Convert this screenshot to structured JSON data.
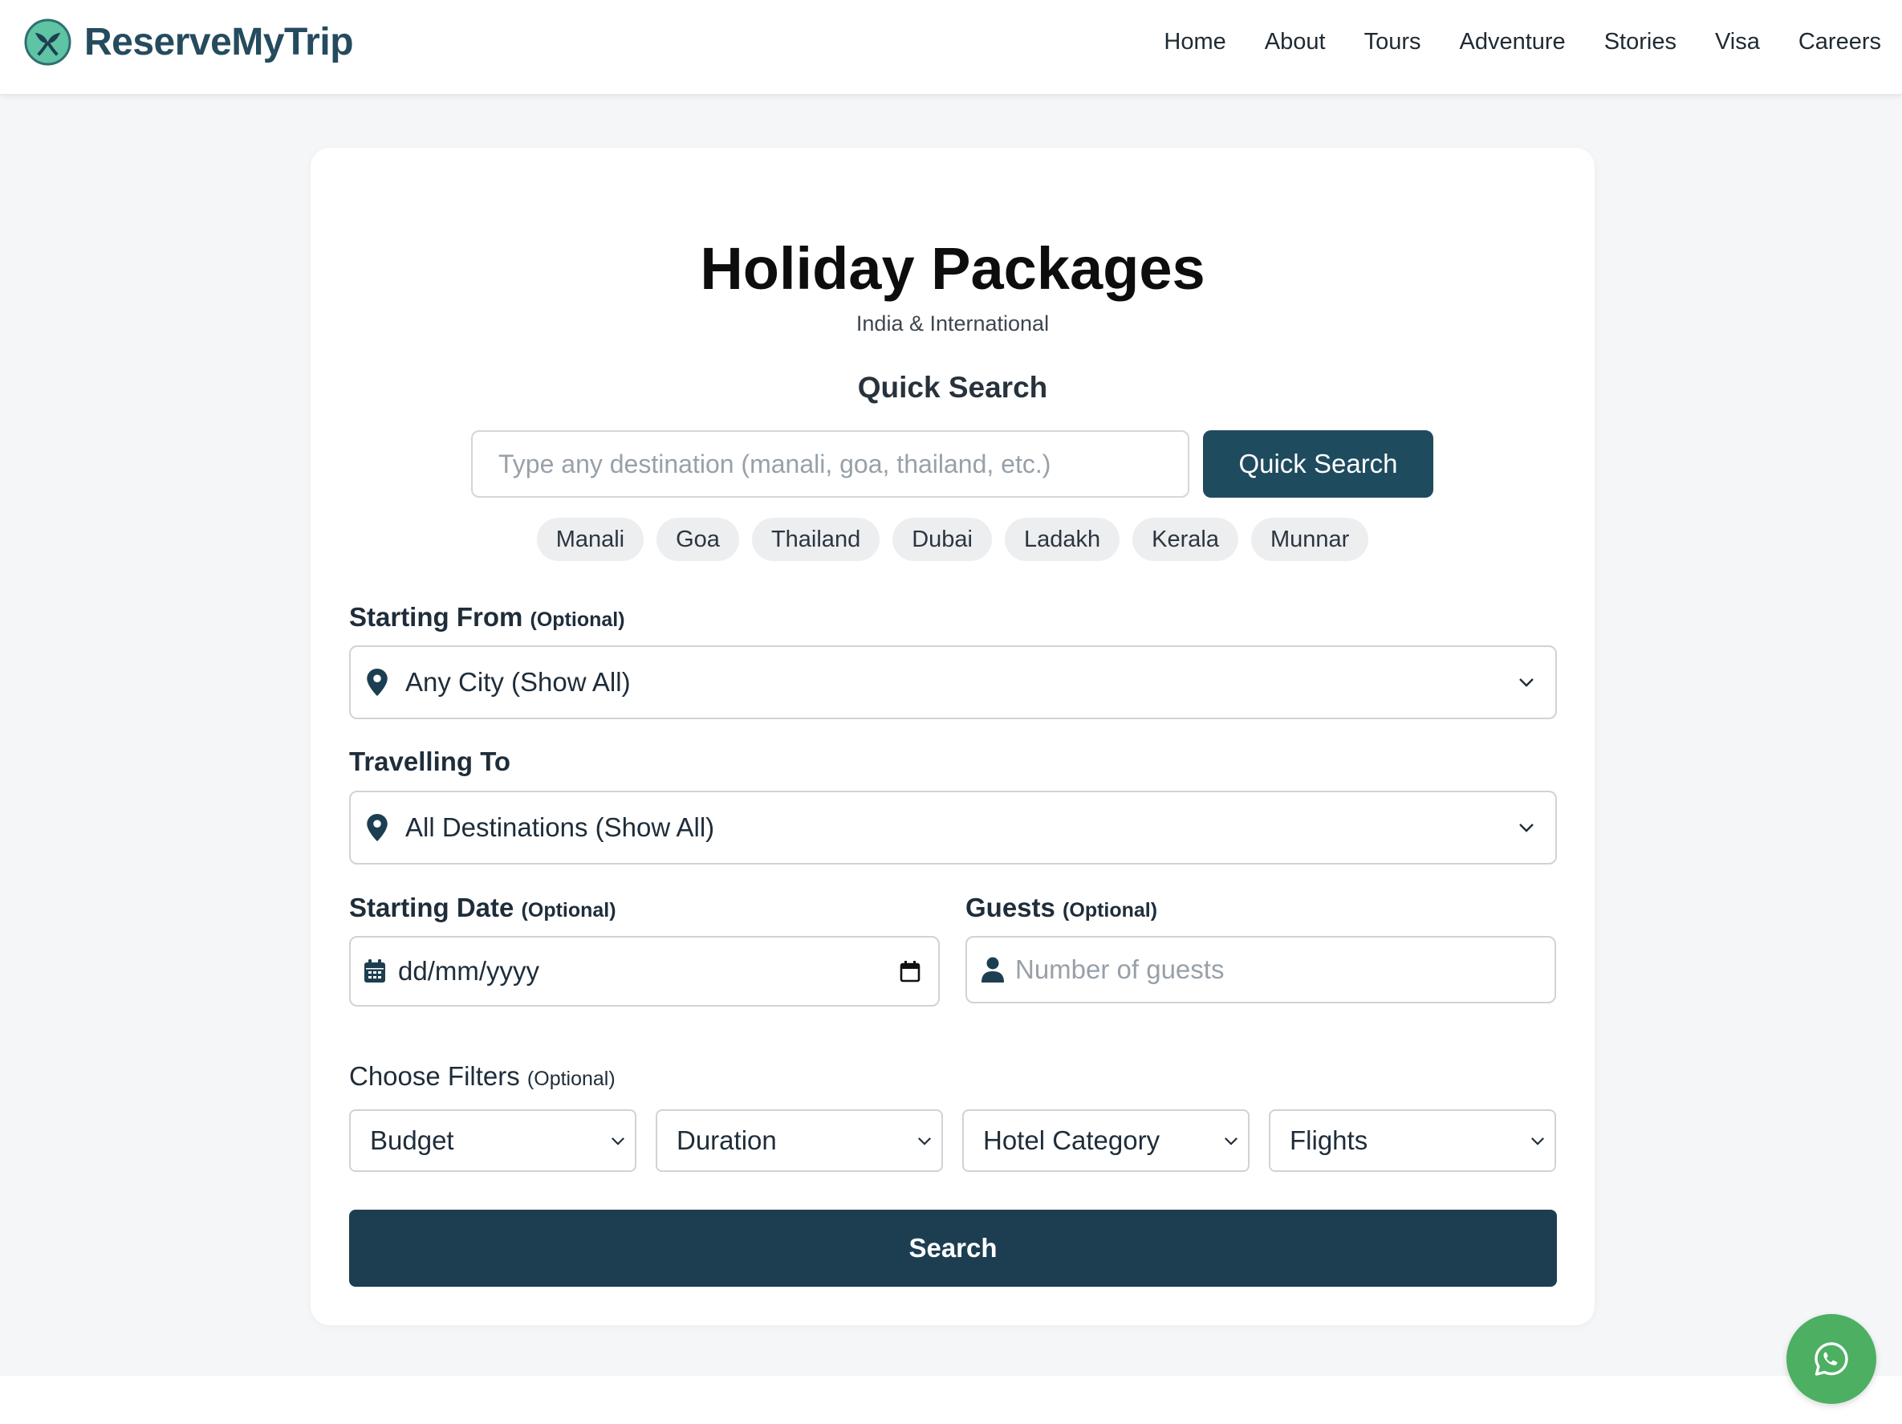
{
  "brand": {
    "name": "ReserveMyTrip",
    "accent": "#1f4b5f",
    "logo_icon": "leaf-globe-icon"
  },
  "nav": [
    "Home",
    "About",
    "Tours",
    "Adventure",
    "Stories",
    "Visa",
    "Careers"
  ],
  "hero": {
    "title": "Holiday Packages",
    "subtitle": "India & International"
  },
  "quick_search": {
    "heading": "Quick Search",
    "placeholder": "Type any destination (manali, goa, thailand, etc.)",
    "button": "Quick Search",
    "chips": [
      "Manali",
      "Goa",
      "Thailand",
      "Dubai",
      "Ladakh",
      "Kerala",
      "Munnar"
    ]
  },
  "form": {
    "starting_from": {
      "label": "Starting From",
      "optional": "(Optional)",
      "value": "Any City (Show All)"
    },
    "travelling_to": {
      "label": "Travelling To",
      "value": "All Destinations (Show All)"
    },
    "starting_date": {
      "label": "Starting Date",
      "optional": "(Optional)",
      "value": "dd/mm/yyyy"
    },
    "guests": {
      "label": "Guests",
      "optional": "(Optional)",
      "placeholder": "Number of guests"
    },
    "filters": {
      "label": "Choose Filters",
      "optional": "(Optional)",
      "items": [
        "Budget",
        "Duration",
        "Hotel Category",
        "Flights"
      ]
    },
    "search_button": "Search"
  },
  "whatsapp": {
    "icon": "whatsapp-icon",
    "color": "#4caf62"
  }
}
